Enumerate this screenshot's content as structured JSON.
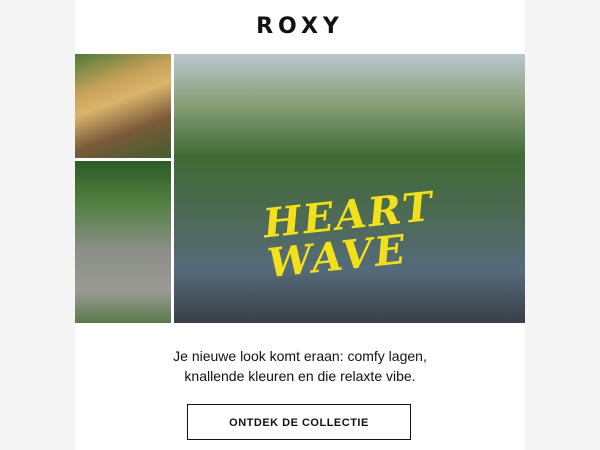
{
  "brand": {
    "logo_text": "ROXY"
  },
  "hero": {
    "title_line1": "HEART",
    "title_line2": "WAVE",
    "title_color": "#f2e11a"
  },
  "content": {
    "tagline_line1": "Je nieuwe look komt eraan: comfy lagen,",
    "tagline_line2": "knallende kleuren en die relaxte vibe."
  },
  "cta": {
    "label": "ONTDEK DE COLLECTIE"
  }
}
